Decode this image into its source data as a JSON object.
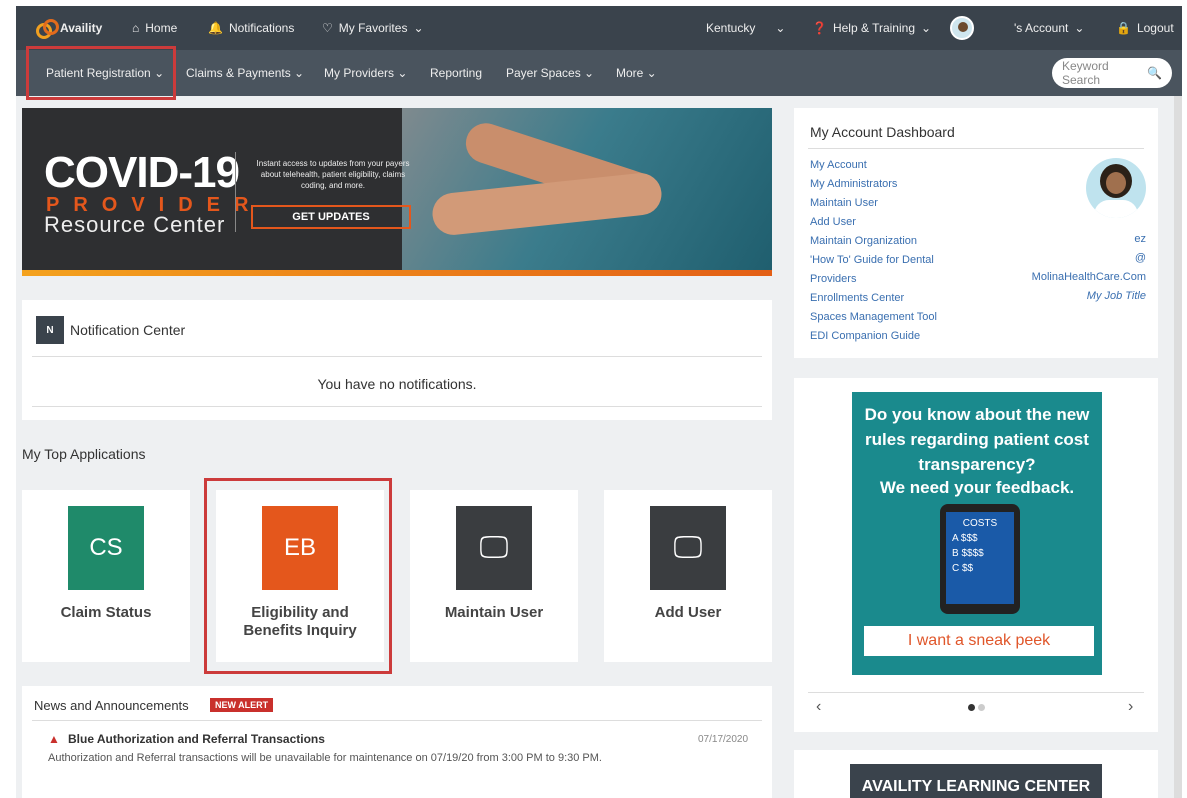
{
  "topbar": {
    "brand": "Availity",
    "home": "Home",
    "notifications": "Notifications",
    "favorites": "My Favorites",
    "state": "Kentucky",
    "help": "Help & Training",
    "account": "'s Account",
    "logout": "Logout"
  },
  "nav": {
    "items": [
      "Patient Registration",
      "Claims & Payments",
      "My Providers",
      "Reporting",
      "Payer Spaces",
      "More"
    ],
    "search_placeholder": "Keyword Search"
  },
  "banner": {
    "title": "COVID-19",
    "provider": "PROVIDER",
    "resource": "Resource Center",
    "text": "Instant access to updates from your payers about telehealth, patient eligibility, claims coding, and more.",
    "button": "GET UPDATES"
  },
  "notifications": {
    "badge": "N",
    "title": "Notification Center",
    "empty": "You have no notifications."
  },
  "apps": {
    "title": "My Top Applications",
    "tiles": [
      {
        "code": "CS",
        "label": "Claim Status",
        "color": "#1f8a6a"
      },
      {
        "code": "EB",
        "label": "Eligibility and Benefits Inquiry",
        "color": "#e4571c"
      },
      {
        "code": "",
        "label": "Maintain User",
        "color": "#3a3d40"
      },
      {
        "code": "",
        "label": "Add User",
        "color": "#3a3d40"
      }
    ]
  },
  "news": {
    "title": "News and Announcements",
    "badge": "NEW ALERT",
    "item_title": "Blue Authorization and Referral Transactions",
    "item_date": "07/17/2020",
    "item_body": "Authorization and Referral transactions will be unavailable for maintenance on 07/19/20 from 3:00 PM to 9:30 PM."
  },
  "dashboard": {
    "title": "My Account Dashboard",
    "links": [
      "My Account",
      "My Administrators",
      "Maintain User",
      "Add User",
      "Maintain Organization",
      "'How To' Guide for Dental",
      "Providers",
      "Enrollments Center",
      "Spaces Management Tool",
      "EDI Companion Guide"
    ],
    "user_name": "ez",
    "user_at": "@",
    "user_domain": "MolinaHealthCare.Com",
    "user_job": "My Job Title"
  },
  "ad": {
    "headline": "Do you know about the new rules regarding patient cost transparency?",
    "sub": "We need your feedback.",
    "phone_lines": [
      "COSTS",
      "A $$$",
      "B $$$$",
      "C $$"
    ],
    "button": "I want a sneak peek"
  },
  "carousel": {
    "prev": "‹",
    "next": "›"
  },
  "learning": {
    "title": "AVAILITY LEARNING CENTER"
  }
}
